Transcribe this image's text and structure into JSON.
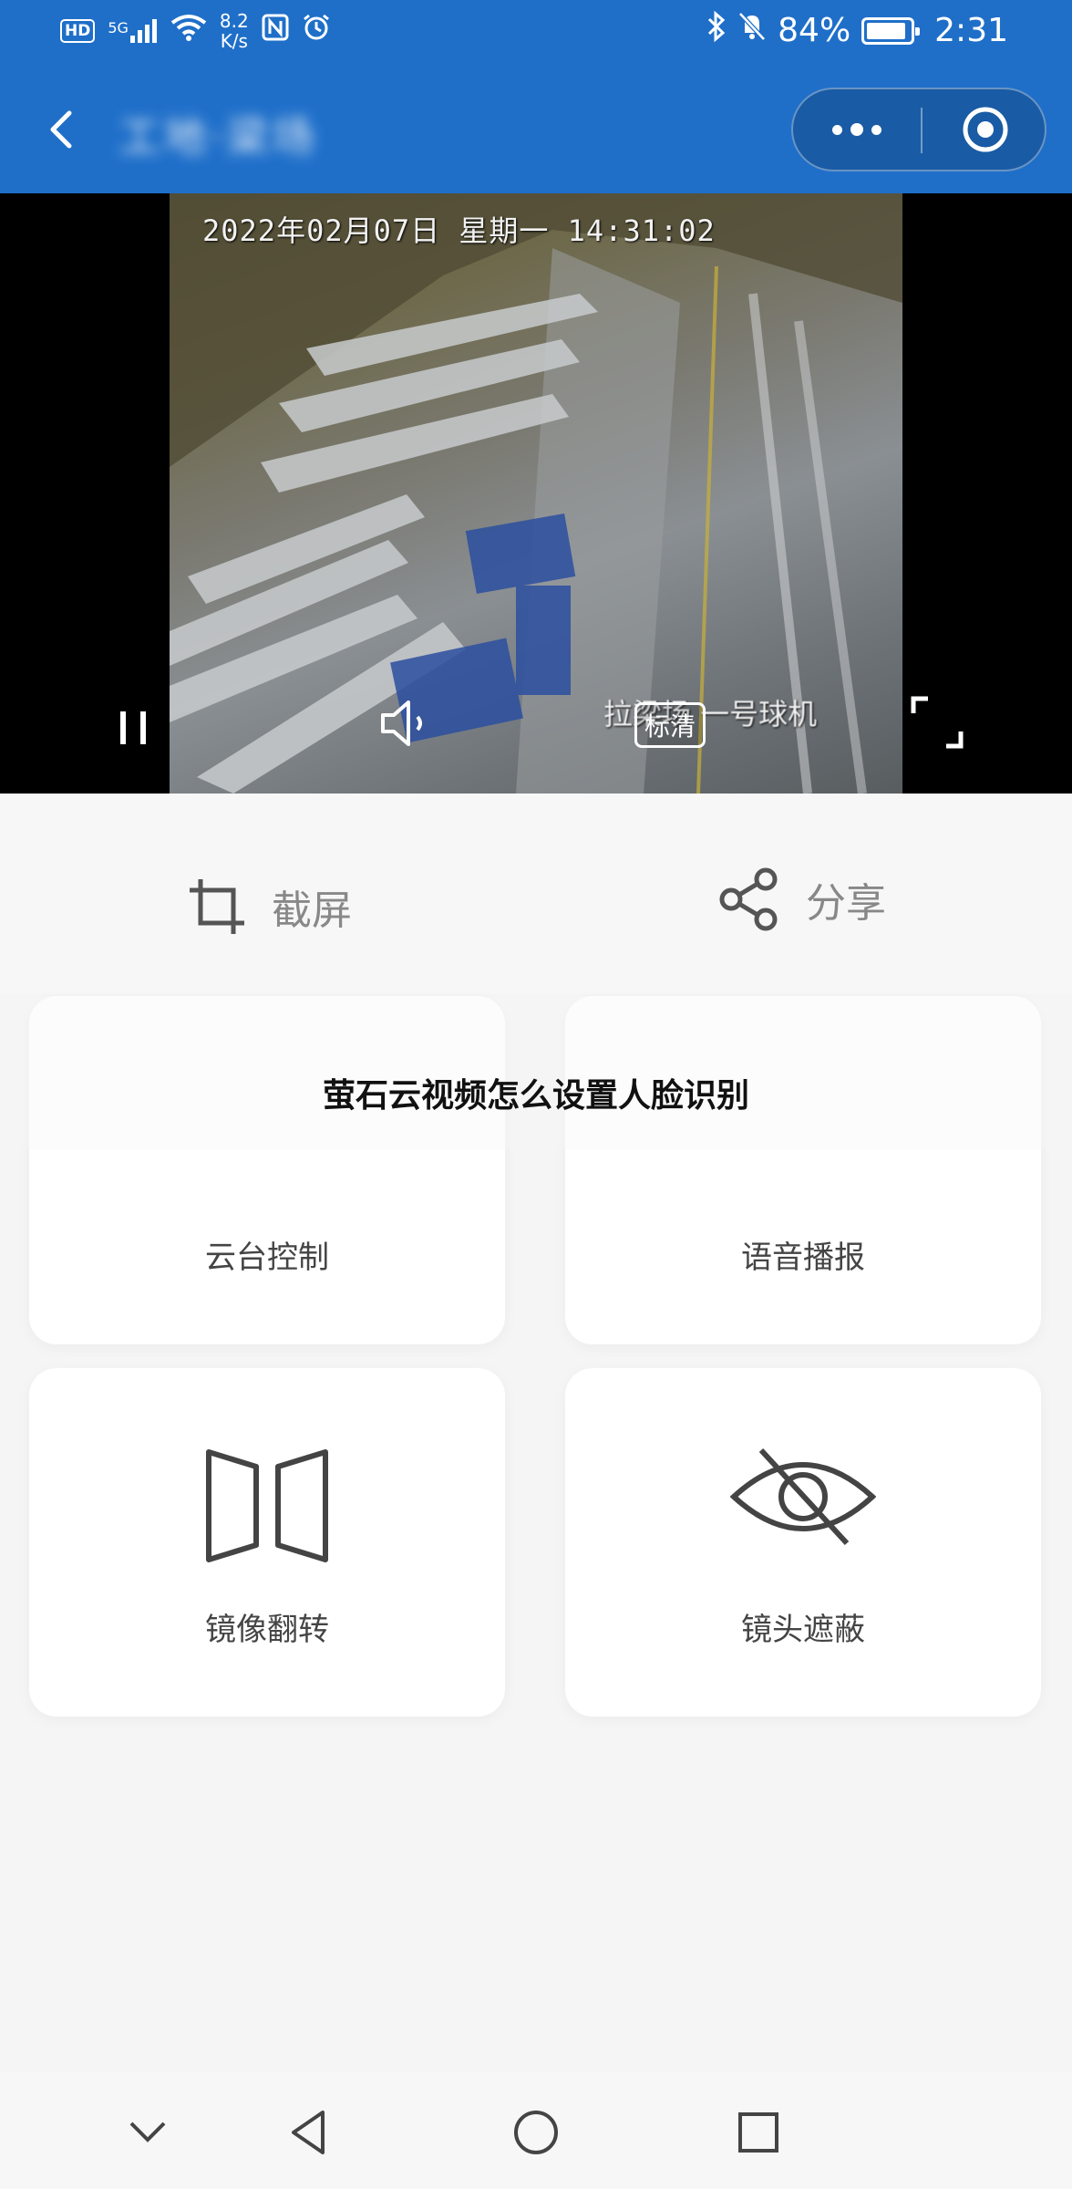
{
  "status_bar": {
    "hd_badge": "HD",
    "network": "5G",
    "speed_value": "8.2",
    "speed_unit": "K/s",
    "battery": "84%",
    "time": "2:31"
  },
  "nav": {
    "title": "工地·梁场"
  },
  "video": {
    "osd_timestamp": "2022年02月07日 星期一 14:31:02",
    "osd_camera": "拉梁场 一号球机",
    "quality_label": "标清"
  },
  "actions": {
    "screenshot": "截屏",
    "share": "分享"
  },
  "cards": {
    "ptz": "云台控制",
    "voice": "语音播报",
    "mirror": "镜像翻转",
    "mask": "镜头遮蔽"
  },
  "overlay": {
    "heading": "萤石云视频怎么设置人脸识别"
  },
  "colors": {
    "brand_blue": "#1f6fc9",
    "background": "#f5f5f5",
    "icon_gray": "#444444"
  }
}
